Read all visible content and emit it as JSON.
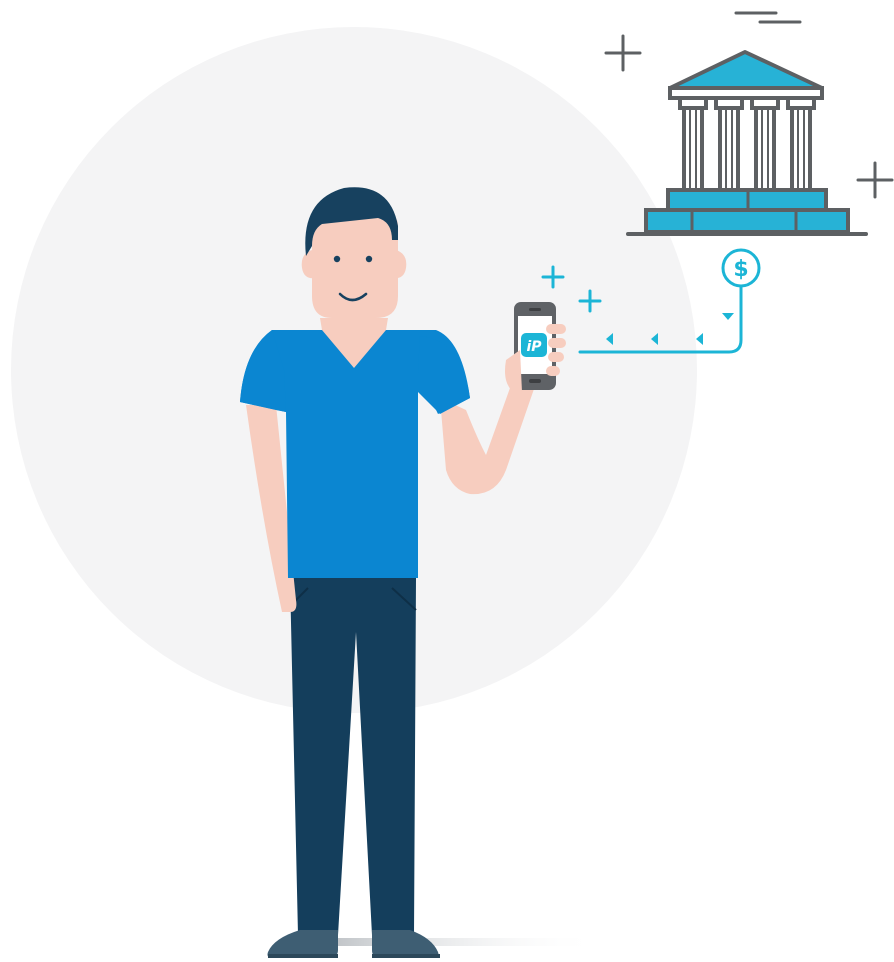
{
  "scene": {
    "description_label": "",
    "app_logo_text": "iP",
    "currency_symbol": "$"
  },
  "colors": {
    "background_circle": "#f4f4f5",
    "shirt": "#0b86d1",
    "shirt_shadow": "#0a77bb",
    "pants": "#143e5c",
    "skin": "#f7cdbf",
    "skin_shadow": "#eab7a6",
    "hair": "#17415f",
    "shoes": "#3e5e73",
    "bank_outline": "#5d6063",
    "bank_fill": "#27b2d6",
    "accent": "#1cb5d6",
    "phone": "#5f6266",
    "deco": "#5d6063"
  },
  "icons": [
    "plus-icon",
    "dash-icon",
    "bank-icon",
    "dollar-coin-icon",
    "arrow-left-icon",
    "phone-icon",
    "app-logo-icon"
  ]
}
